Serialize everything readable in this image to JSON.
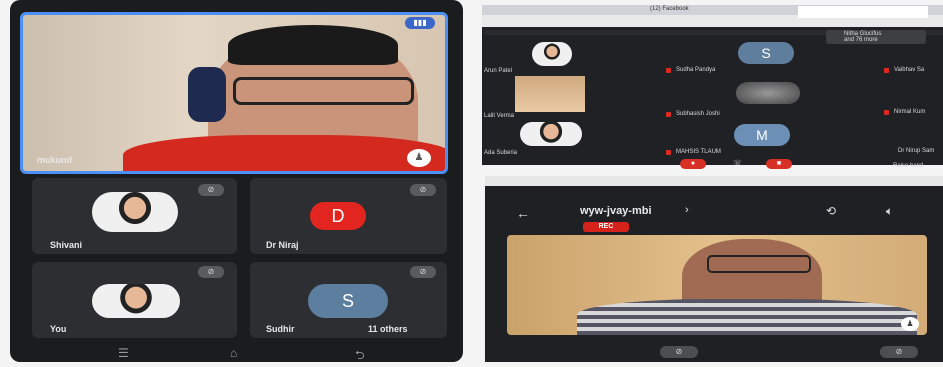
{
  "left": {
    "main_name": "mukund",
    "participants": [
      {
        "name": "Shivani"
      },
      {
        "name": "Dr Niraj",
        "initial": "D"
      },
      {
        "name": "You"
      },
      {
        "name": "Sudhir",
        "initial": "S",
        "extra": "11 others"
      }
    ],
    "mic_icon_glyph": "⊘"
  },
  "laptop": {
    "tab_label": "(12) Facebook",
    "meet_info_a": "Nitha Glucifus",
    "meet_info_b": "and 76 more",
    "rows": [
      {
        "left_name": "Arun Patel",
        "mid_name": "Sudha Pandya",
        "right_name": "Vaibhav Sa"
      },
      {
        "left_name": "Lalit Verma",
        "mid_name": "Subhasish Joshi",
        "right_name": "Nirmal Kum"
      },
      {
        "left_name": "Ada Suberia",
        "mid_name": "MAHSIS TLAUM",
        "right_name": "Dr Nirup Sam"
      }
    ],
    "avatar_s": "S",
    "avatar_m": "M",
    "tooltip": "Raise hand"
  },
  "phone2": {
    "title": "wyw-jvay-mbi",
    "rec_label": "REC",
    "title_arrow": "›"
  },
  "colors": {
    "accent_blue": "#4b8ff7",
    "avatar_red": "#e2261f",
    "rec_red": "#d5231c"
  }
}
